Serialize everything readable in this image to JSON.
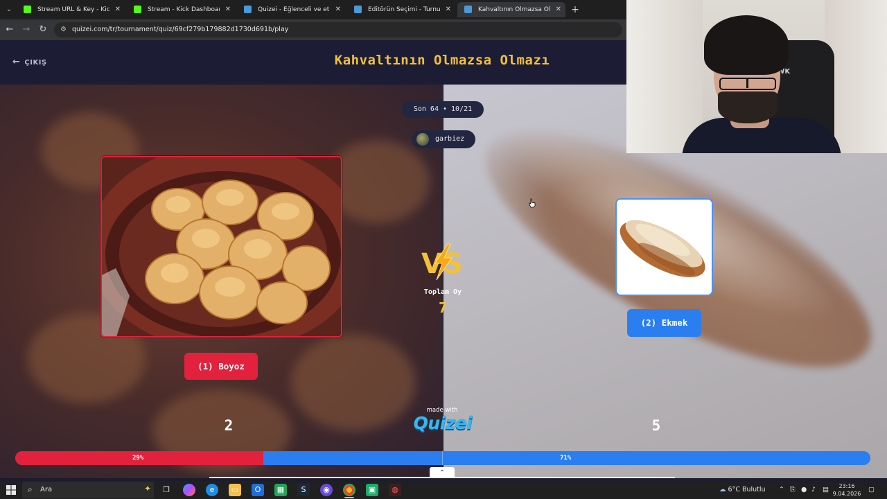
{
  "browser": {
    "tabs": [
      {
        "label": "Stream URL & Key - Kick Dashb",
        "favicon": "kick-icon",
        "color": "#53fc18"
      },
      {
        "label": "Stream - Kick Dashboard",
        "favicon": "kick-icon",
        "color": "#53fc18"
      },
      {
        "label": "Quizei - Eğlenceli ve etkileşimli",
        "favicon": "quizei-icon",
        "color": "#4a9ad8"
      },
      {
        "label": "Editörün Seçimi - Turnuva - Qu",
        "favicon": "quizei-icon",
        "color": "#4a9ad8"
      },
      {
        "label": "Kahvaltının Olmazsa Olmazı - T",
        "favicon": "quizei-icon",
        "color": "#4a9ad8"
      }
    ],
    "url": "quizei.com/tr/tournament/quiz/69cf279b179882d1730d691b/play"
  },
  "header": {
    "exit_label": "ÇIKIŞ",
    "title": "Kahvaltının Olmazsa Olmazı"
  },
  "round": {
    "label": "Son 64 • 10/21",
    "creator": "garbiez"
  },
  "matchup": {
    "left": {
      "label": "(1) Boyoz",
      "votes": "2",
      "percent_label": "29%",
      "percent": 29,
      "color": "#e2213c"
    },
    "right": {
      "label": "(2) Ekmek",
      "votes": "5",
      "percent_label": "71%",
      "percent": 71,
      "color": "#2a7ef0"
    },
    "vs_label": "VS",
    "total_label": "Toplam Oy",
    "total_value": "7"
  },
  "footer": {
    "made_with": "made with",
    "brand": "Quizei"
  },
  "webcam": {
    "chair_text": "AWK"
  },
  "taskbar": {
    "search_placeholder": "Ara",
    "weather": "6°C Bulutlu",
    "time": "23:16",
    "date": "9.04.2026"
  }
}
